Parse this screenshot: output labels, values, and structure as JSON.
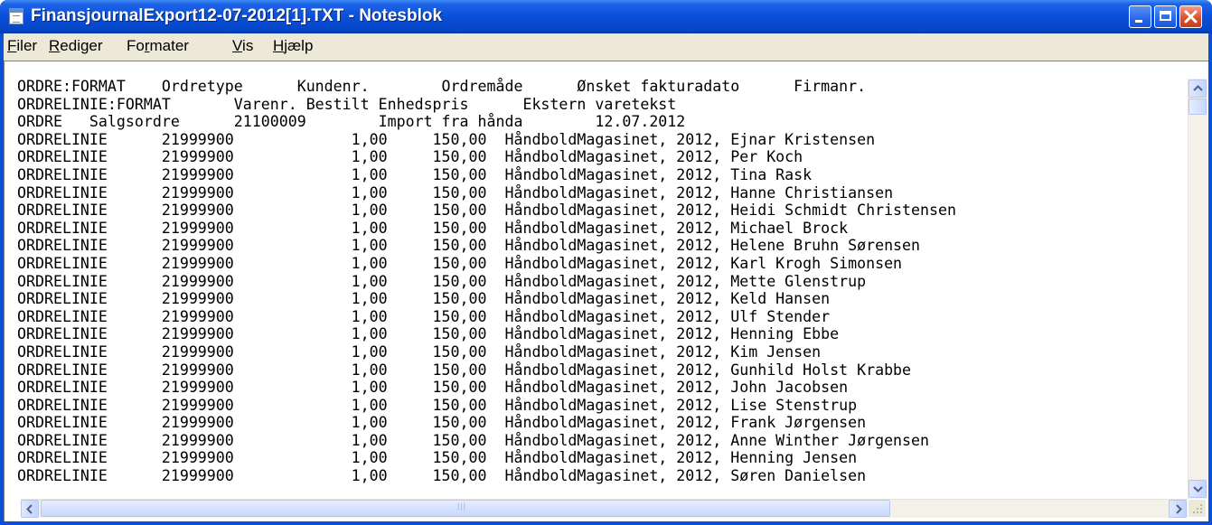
{
  "window": {
    "title": "FinansjournalExport12-07-2012[1].TXT - Notesblok"
  },
  "menu": {
    "items": [
      {
        "key": "file",
        "underline": "F",
        "rest": "iler"
      },
      {
        "key": "edit",
        "underline": "R",
        "rest": "ediger"
      },
      {
        "key": "format",
        "pre": "Fo",
        "underline": "r",
        "rest": "mater"
      },
      {
        "key": "view",
        "underline": "V",
        "rest": "is"
      },
      {
        "key": "help",
        "underline": "H",
        "rest": "jælp"
      }
    ]
  },
  "editor": {
    "lines": [
      "ORDRE:FORMAT    Ordretype      Kundenr.        Ordremåde      Ønsket fakturadato      Firmanr.",
      "ORDRELINIE:FORMAT       Varenr. Bestilt Enhedspris      Ekstern varetekst",
      "ORDRE   Salgsordre      21100009        Import fra hånda        12.07.2012",
      "ORDRELINIE      21999900             1,00     150,00  HåndboldMagasinet, 2012, Ejnar Kristensen",
      "ORDRELINIE      21999900             1,00     150,00  HåndboldMagasinet, 2012, Per Koch",
      "ORDRELINIE      21999900             1,00     150,00  HåndboldMagasinet, 2012, Tina Rask",
      "ORDRELINIE      21999900             1,00     150,00  HåndboldMagasinet, 2012, Hanne Christiansen",
      "ORDRELINIE      21999900             1,00     150,00  HåndboldMagasinet, 2012, Heidi Schmidt Christensen",
      "ORDRELINIE      21999900             1,00     150,00  HåndboldMagasinet, 2012, Michael Brock",
      "ORDRELINIE      21999900             1,00     150,00  HåndboldMagasinet, 2012, Helene Bruhn Sørensen",
      "ORDRELINIE      21999900             1,00     150,00  HåndboldMagasinet, 2012, Karl Krogh Simonsen",
      "ORDRELINIE      21999900             1,00     150,00  HåndboldMagasinet, 2012, Mette Glenstrup",
      "ORDRELINIE      21999900             1,00     150,00  HåndboldMagasinet, 2012, Keld Hansen",
      "ORDRELINIE      21999900             1,00     150,00  HåndboldMagasinet, 2012, Ulf Stender",
      "ORDRELINIE      21999900             1,00     150,00  HåndboldMagasinet, 2012, Henning Ebbe",
      "ORDRELINIE      21999900             1,00     150,00  HåndboldMagasinet, 2012, Kim Jensen",
      "ORDRELINIE      21999900             1,00     150,00  HåndboldMagasinet, 2012, Gunhild Holst Krabbe",
      "ORDRELINIE      21999900             1,00     150,00  HåndboldMagasinet, 2012, John Jacobsen",
      "ORDRELINIE      21999900             1,00     150,00  HåndboldMagasinet, 2012, Lise Stenstrup",
      "ORDRELINIE      21999900             1,00     150,00  HåndboldMagasinet, 2012, Frank Jørgensen",
      "ORDRELINIE      21999900             1,00     150,00  HåndboldMagasinet, 2012, Anne Winther Jørgensen",
      "ORDRELINIE      21999900             1,00     150,00  HåndboldMagasinet, 2012, Henning Jensen",
      "ORDRELINIE      21999900             1,00     150,00  HåndboldMagasinet, 2012, Søren Danielsen"
    ]
  },
  "icons": {
    "app": "notepad-icon",
    "minimize": "minimize-icon",
    "maximize": "maximize-icon",
    "close": "close-icon",
    "scroll_up": "arrow-up-icon",
    "scroll_down": "arrow-down-icon",
    "scroll_left": "arrow-left-icon",
    "scroll_right": "arrow-right-icon"
  }
}
